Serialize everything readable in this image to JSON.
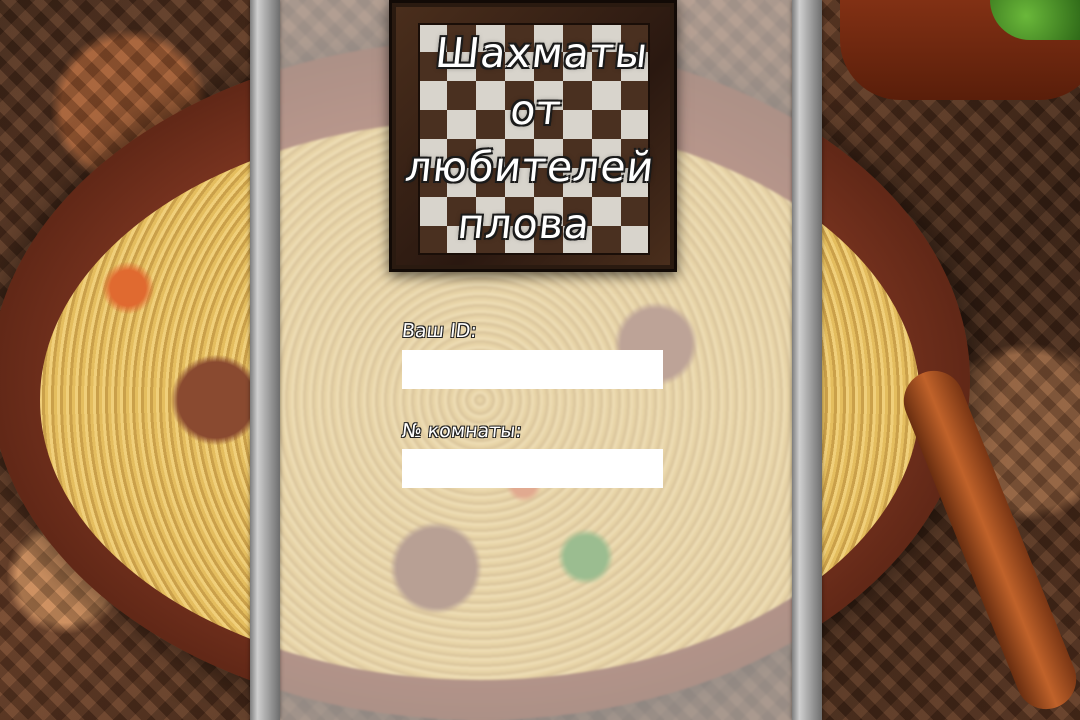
{
  "logo": {
    "title_lines": [
      "Шахматы",
      "от",
      "любителей",
      "плова"
    ]
  },
  "form": {
    "id_label": "Ваш ID:",
    "id_value": "",
    "room_label": "№ комнаты:",
    "room_value": ""
  },
  "colors": {
    "panel_overlay": "#ebe8e4",
    "input_background": "#ffffff",
    "label_text": "#ffffff",
    "board_dark": "#4a3020",
    "board_light": "#d8d4cc"
  }
}
